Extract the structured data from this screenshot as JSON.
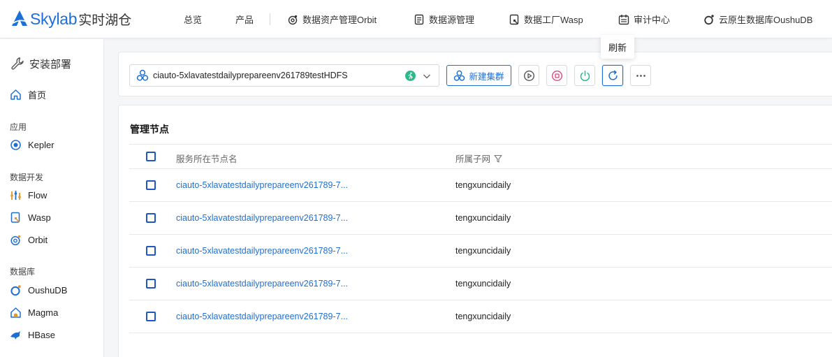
{
  "brand": {
    "sky": "Skylab",
    "sub": "实时湖仓"
  },
  "nav": [
    {
      "label": "总览",
      "icon": "none"
    },
    {
      "label": "产品",
      "icon": "none"
    },
    {
      "label": "数据资产管理Orbit",
      "icon": "orbit-icon"
    },
    {
      "label": "数据源管理",
      "icon": "document-icon"
    },
    {
      "label": "数据工厂Wasp",
      "icon": "wasp-icon"
    },
    {
      "label": "审计中心",
      "icon": "calendar-icon"
    },
    {
      "label": "云原生数据库OushuDB",
      "icon": "oushudb-icon"
    }
  ],
  "sidebar": {
    "deploy": "安装部署",
    "home": "首页",
    "groups": {
      "apps": "应用",
      "dev": "数据开发",
      "db": "数据库"
    },
    "items": {
      "kepler": "Kepler",
      "flow": "Flow",
      "wasp": "Wasp",
      "orbit": "Orbit",
      "oushudb": "OushuDB",
      "magma": "Magma",
      "hbase": "HBase"
    }
  },
  "toolbar": {
    "cluster_name": "ciauto-5xlavatestdailyprepareenv261789testHDFS",
    "new_cluster": "新建集群",
    "tooltip": "刷新",
    "colors": {
      "primary": "#1f6fd3",
      "stop": "#e0467a",
      "power": "#2cb98a",
      "running": "#2cb98a"
    }
  },
  "section": {
    "title": "管理节点"
  },
  "table": {
    "headers": {
      "node_name": "服务所在节点名",
      "subnet": "所属子网"
    },
    "rows": [
      {
        "node": "ciauto-5xlavatestdailyprepareenv261789-7...",
        "subnet": "tengxuncidaily"
      },
      {
        "node": "ciauto-5xlavatestdailyprepareenv261789-7...",
        "subnet": "tengxuncidaily"
      },
      {
        "node": "ciauto-5xlavatestdailyprepareenv261789-7...",
        "subnet": "tengxuncidaily"
      },
      {
        "node": "ciauto-5xlavatestdailyprepareenv261789-7...",
        "subnet": "tengxuncidaily"
      },
      {
        "node": "ciauto-5xlavatestdailyprepareenv261789-7...",
        "subnet": "tengxuncidaily"
      }
    ]
  }
}
